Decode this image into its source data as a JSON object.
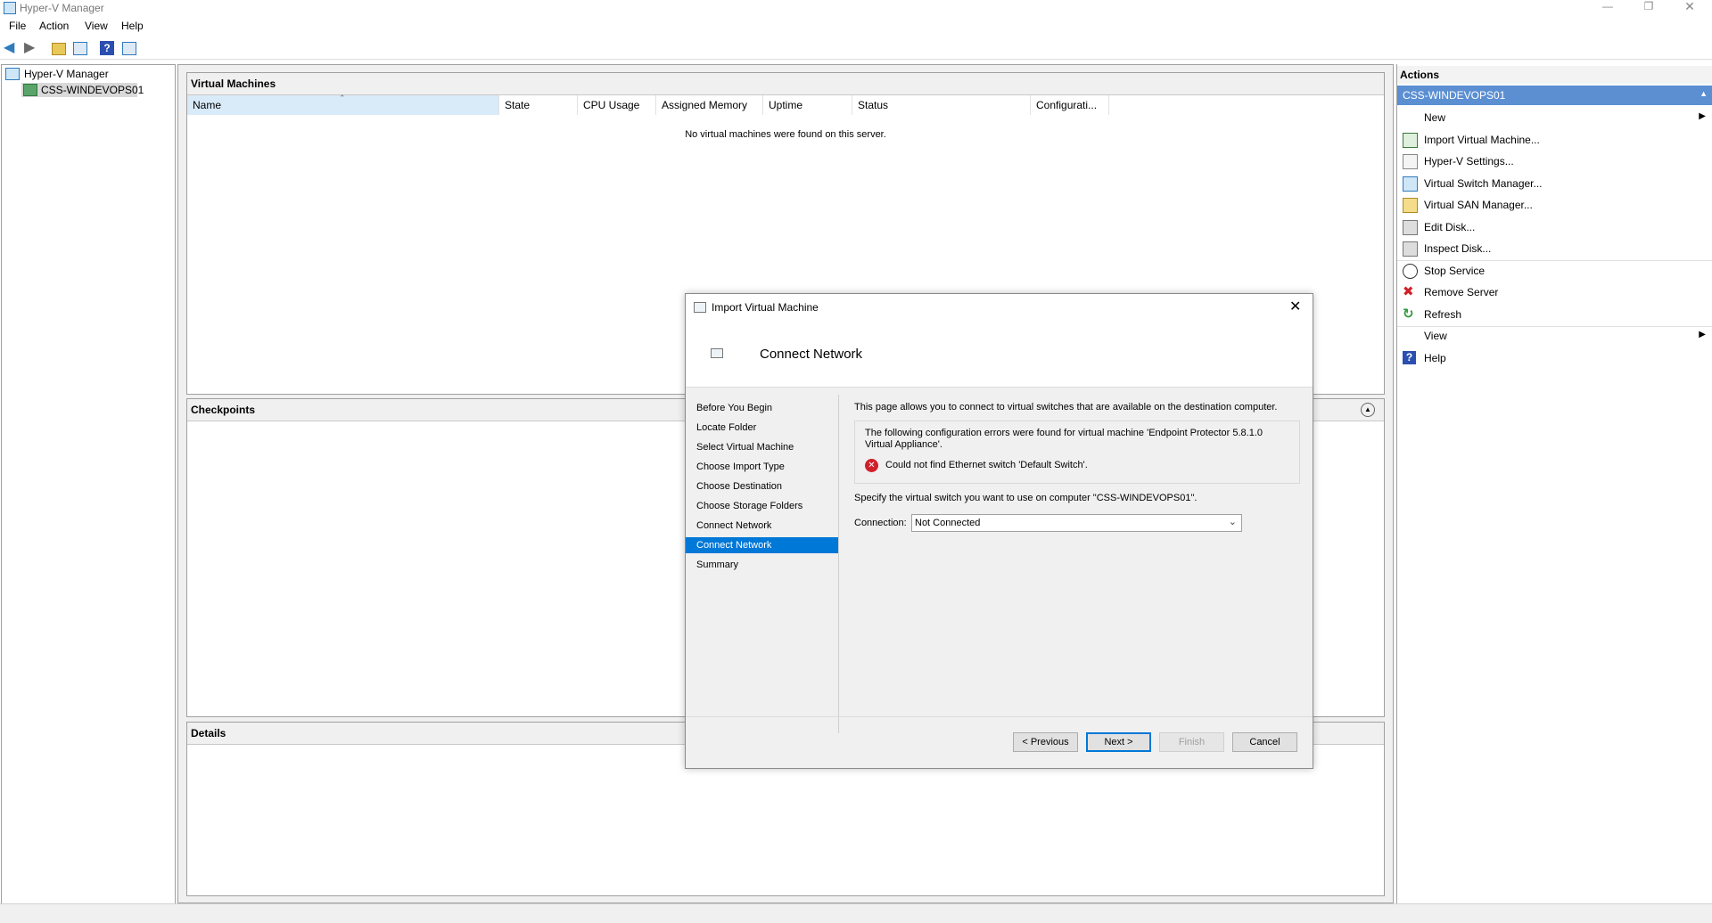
{
  "window": {
    "title": "Hyper-V Manager"
  },
  "menu": [
    "File",
    "Action",
    "View",
    "Help"
  ],
  "tree": {
    "root": "Hyper-V Manager",
    "server": "CSS-WINDEVOPS01"
  },
  "vm_panel": {
    "title": "Virtual Machines",
    "columns": [
      "Name",
      "State",
      "CPU Usage",
      "Assigned Memory",
      "Uptime",
      "Status",
      "Configurati..."
    ],
    "empty_message": "No virtual machines were found on this server."
  },
  "checkpoints_panel": {
    "title": "Checkpoints"
  },
  "details_panel": {
    "title": "Details"
  },
  "actions": {
    "title": "Actions",
    "group": "CSS-WINDEVOPS01",
    "items": [
      {
        "label": "New",
        "icon": "none"
      },
      {
        "label": "Import Virtual Machine...",
        "icon": "import-vm-icon"
      },
      {
        "label": "Hyper-V Settings...",
        "icon": "settings-icon"
      },
      {
        "label": "Virtual Switch Manager...",
        "icon": "switch-manager-icon"
      },
      {
        "label": "Virtual SAN Manager...",
        "icon": "san-manager-icon"
      },
      {
        "label": "Edit Disk...",
        "icon": "edit-disk-icon"
      },
      {
        "label": "Inspect Disk...",
        "icon": "inspect-disk-icon"
      },
      {
        "label": "Stop Service",
        "icon": "stop-icon"
      },
      {
        "label": "Remove Server",
        "icon": "remove-icon"
      },
      {
        "label": "Refresh",
        "icon": "refresh-icon"
      },
      {
        "label": "View",
        "icon": "none"
      },
      {
        "label": "Help",
        "icon": "help-icon"
      }
    ]
  },
  "dialog": {
    "title": "Import Virtual Machine",
    "heading": "Connect Network",
    "nav": [
      "Before You Begin",
      "Locate Folder",
      "Select Virtual Machine",
      "Choose Import Type",
      "Choose Destination",
      "Choose Storage Folders",
      "Connect Network",
      "Connect Network",
      "Summary"
    ],
    "selected_nav_index": 7,
    "intro": "This page allows you to connect to virtual switches that are available on the destination computer.",
    "error_box_line1": "The following configuration errors were found for virtual machine 'Endpoint Protector 5.8.1.0",
    "error_box_line2": "Virtual Appliance'.",
    "error_message": "Could not find Ethernet switch 'Default Switch'.",
    "specify_text": "Specify the virtual switch you want to use on computer \"CSS-WINDEVOPS01\".",
    "connection_label": "Connection:",
    "connection_value": "Not Connected",
    "buttons": {
      "previous": "< Previous",
      "next": "Next >",
      "finish": "Finish",
      "cancel": "Cancel"
    }
  }
}
